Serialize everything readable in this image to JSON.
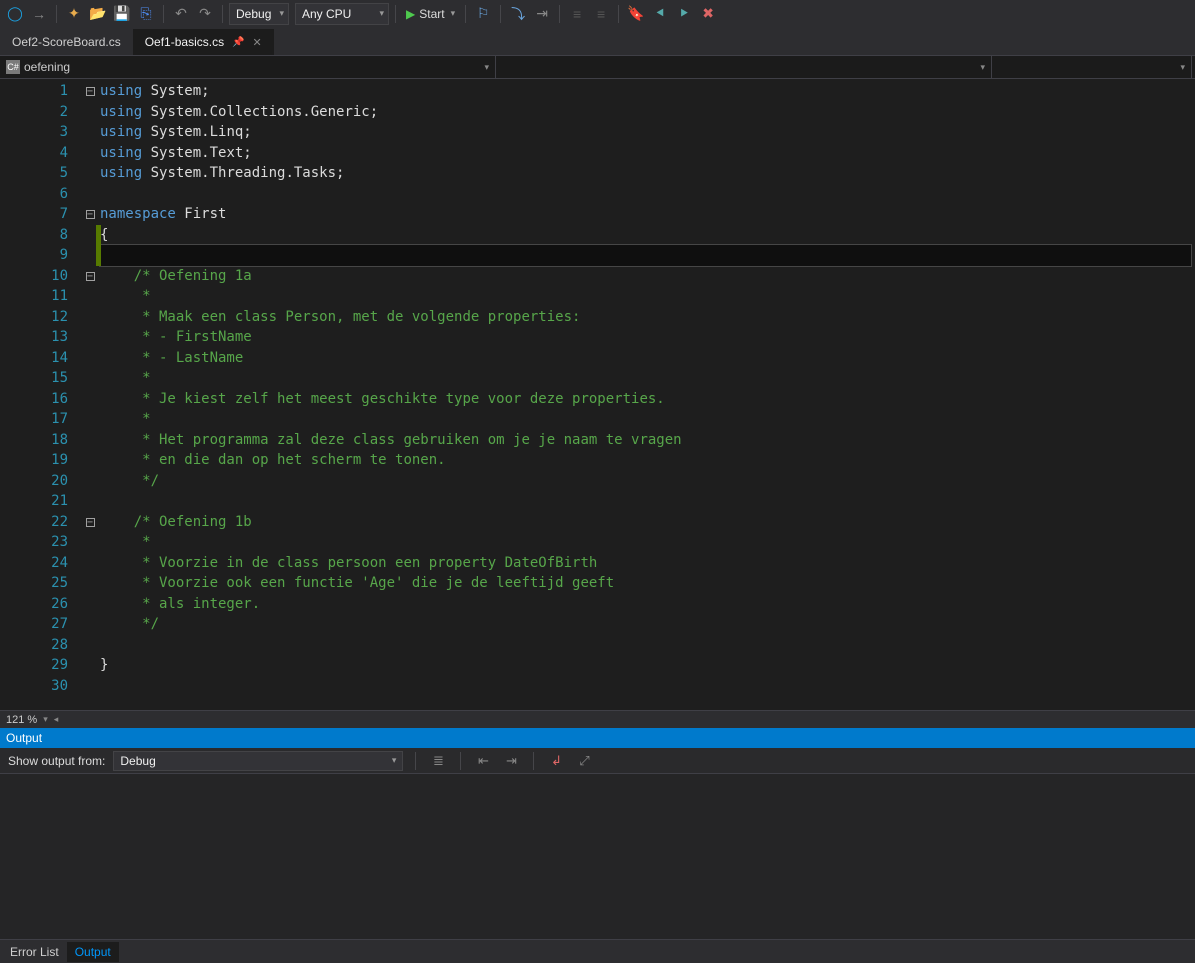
{
  "toolbar": {
    "config": "Debug",
    "platform": "Any CPU",
    "start": "Start"
  },
  "tabs": [
    {
      "label": "Oef2-ScoreBoard.cs",
      "active": false
    },
    {
      "label": "Oef1-basics.cs",
      "active": true
    }
  ],
  "navbar": {
    "left": "oefening",
    "mid": "",
    "right": ""
  },
  "code": {
    "lines": [
      {
        "n": 1,
        "fold": "minus",
        "segs": [
          [
            "kw",
            "using"
          ],
          [
            "txt",
            " System;"
          ]
        ]
      },
      {
        "n": 2,
        "segs": [
          [
            "kw",
            "using"
          ],
          [
            "txt",
            " System.Collections.Generic;"
          ]
        ]
      },
      {
        "n": 3,
        "segs": [
          [
            "kw",
            "using"
          ],
          [
            "txt",
            " System.Linq;"
          ]
        ]
      },
      {
        "n": 4,
        "segs": [
          [
            "kw",
            "using"
          ],
          [
            "txt",
            " System.Text;"
          ]
        ]
      },
      {
        "n": 5,
        "segs": [
          [
            "kw",
            "using"
          ],
          [
            "txt",
            " System.Threading.Tasks;"
          ]
        ]
      },
      {
        "n": 6,
        "segs": []
      },
      {
        "n": 7,
        "fold": "minus",
        "segs": [
          [
            "kw",
            "namespace"
          ],
          [
            "txt",
            " First"
          ]
        ]
      },
      {
        "n": 8,
        "modified": true,
        "segs": [
          [
            "txt",
            "{"
          ]
        ]
      },
      {
        "n": 9,
        "modified": true,
        "cur": true,
        "segs": [
          [
            "txt",
            "    "
          ]
        ]
      },
      {
        "n": 10,
        "fold": "minus",
        "segs": [
          [
            "txt",
            "    "
          ],
          [
            "cm",
            "/* Oefening 1a"
          ]
        ]
      },
      {
        "n": 11,
        "segs": [
          [
            "txt",
            "    "
          ],
          [
            "cm",
            " * "
          ]
        ]
      },
      {
        "n": 12,
        "segs": [
          [
            "txt",
            "    "
          ],
          [
            "cm",
            " * Maak een class Person, met de volgende properties:"
          ]
        ]
      },
      {
        "n": 13,
        "segs": [
          [
            "txt",
            "    "
          ],
          [
            "cm",
            " * - FirstName"
          ]
        ]
      },
      {
        "n": 14,
        "segs": [
          [
            "txt",
            "    "
          ],
          [
            "cm",
            " * - LastName"
          ]
        ]
      },
      {
        "n": 15,
        "segs": [
          [
            "txt",
            "    "
          ],
          [
            "cm",
            " * "
          ]
        ]
      },
      {
        "n": 16,
        "segs": [
          [
            "txt",
            "    "
          ],
          [
            "cm",
            " * Je kiest zelf het meest geschikte type voor deze properties."
          ]
        ]
      },
      {
        "n": 17,
        "segs": [
          [
            "txt",
            "    "
          ],
          [
            "cm",
            " * "
          ]
        ]
      },
      {
        "n": 18,
        "segs": [
          [
            "txt",
            "    "
          ],
          [
            "cm",
            " * Het programma zal deze class gebruiken om je je naam te vragen"
          ]
        ]
      },
      {
        "n": 19,
        "segs": [
          [
            "txt",
            "    "
          ],
          [
            "cm",
            " * en die dan op het scherm te tonen."
          ]
        ]
      },
      {
        "n": 20,
        "segs": [
          [
            "txt",
            "    "
          ],
          [
            "cm",
            " */"
          ]
        ]
      },
      {
        "n": 21,
        "segs": []
      },
      {
        "n": 22,
        "fold": "minus",
        "segs": [
          [
            "txt",
            "    "
          ],
          [
            "cm",
            "/* Oefening 1b"
          ]
        ]
      },
      {
        "n": 23,
        "segs": [
          [
            "txt",
            "    "
          ],
          [
            "cm",
            " * "
          ]
        ]
      },
      {
        "n": 24,
        "segs": [
          [
            "txt",
            "    "
          ],
          [
            "cm",
            " * Voorzie in de class persoon een property DateOfBirth"
          ]
        ]
      },
      {
        "n": 25,
        "segs": [
          [
            "txt",
            "    "
          ],
          [
            "cm",
            " * Voorzie ook een functie 'Age' die je de leeftijd geeft"
          ]
        ]
      },
      {
        "n": 26,
        "segs": [
          [
            "txt",
            "    "
          ],
          [
            "cm",
            " * als integer."
          ]
        ]
      },
      {
        "n": 27,
        "segs": [
          [
            "txt",
            "    "
          ],
          [
            "cm",
            " */"
          ]
        ]
      },
      {
        "n": 28,
        "segs": []
      },
      {
        "n": 29,
        "segs": [
          [
            "txt",
            "}"
          ]
        ]
      },
      {
        "n": 30,
        "segs": []
      }
    ]
  },
  "zoom": "121 %",
  "output": {
    "title": "Output",
    "from_label": "Show output from:",
    "from_value": "Debug"
  },
  "bottom_tabs": [
    {
      "label": "Error List",
      "active": false
    },
    {
      "label": "Output",
      "active": true
    }
  ]
}
